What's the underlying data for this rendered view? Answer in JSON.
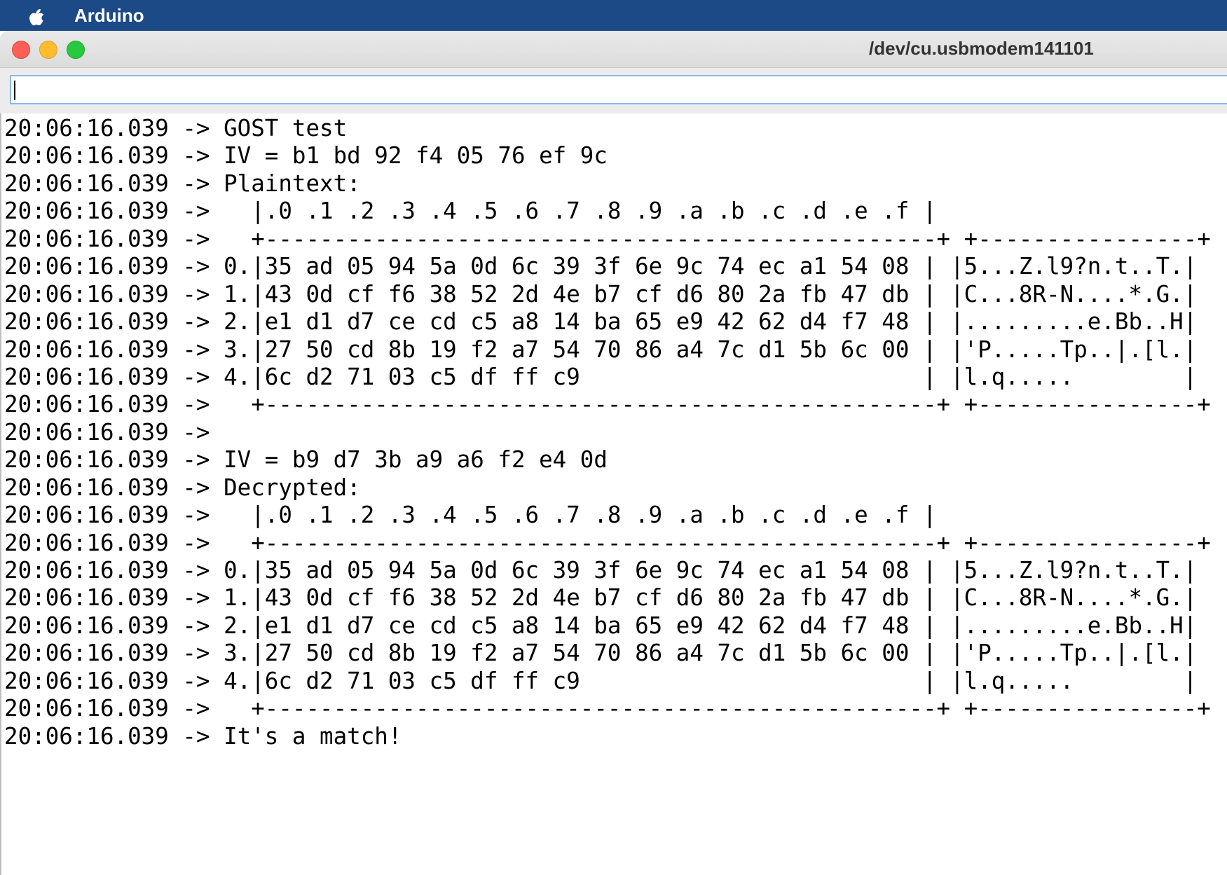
{
  "menubar": {
    "apple_icon": "apple-logo-icon",
    "app_name": "Arduino"
  },
  "window": {
    "title": "/dev/cu.usbmodem141101",
    "traffic_lights": [
      "close-icon",
      "minimize-icon",
      "zoom-icon"
    ]
  },
  "send_input": {
    "value": ""
  },
  "serial_output": {
    "lines": [
      "20:06:16.039 -> GOST test",
      "20:06:16.039 -> IV = b1 bd 92 f4 05 76 ef 9c",
      "20:06:16.039 -> Plaintext:",
      "20:06:16.039 ->   |.0 .1 .2 .3 .4 .5 .6 .7 .8 .9 .a .b .c .d .e .f |",
      "20:06:16.039 ->   +-------------------------------------------------+ +----------------+",
      "20:06:16.039 -> 0.|35 ad 05 94 5a 0d 6c 39 3f 6e 9c 74 ec a1 54 08 | |5...Z.l9?n.t..T.|",
      "20:06:16.039 -> 1.|43 0d cf f6 38 52 2d 4e b7 cf d6 80 2a fb 47 db | |C...8R-N....*.G.|",
      "20:06:16.039 -> 2.|e1 d1 d7 ce cd c5 a8 14 ba 65 e9 42 62 d4 f7 48 | |.........e.Bb..H|",
      "20:06:16.039 -> 3.|27 50 cd 8b 19 f2 a7 54 70 86 a4 7c d1 5b 6c 00 | |'P.....Tp..|.[l.|",
      "20:06:16.039 -> 4.|6c d2 71 03 c5 df ff c9                         | |l.q.....        |",
      "20:06:16.039 ->   +-------------------------------------------------+ +----------------+",
      "20:06:16.039 -> ",
      "20:06:16.039 -> IV = b9 d7 3b a9 a6 f2 e4 0d",
      "20:06:16.039 -> Decrypted:",
      "20:06:16.039 ->   |.0 .1 .2 .3 .4 .5 .6 .7 .8 .9 .a .b .c .d .e .f |",
      "20:06:16.039 ->   +-------------------------------------------------+ +----------------+",
      "20:06:16.039 -> 0.|35 ad 05 94 5a 0d 6c 39 3f 6e 9c 74 ec a1 54 08 | |5...Z.l9?n.t..T.|",
      "20:06:16.039 -> 1.|43 0d cf f6 38 52 2d 4e b7 cf d6 80 2a fb 47 db | |C...8R-N....*.G.|",
      "20:06:16.039 -> 2.|e1 d1 d7 ce cd c5 a8 14 ba 65 e9 42 62 d4 f7 48 | |.........e.Bb..H|",
      "20:06:16.039 -> 3.|27 50 cd 8b 19 f2 a7 54 70 86 a4 7c d1 5b 6c 00 | |'P.....Tp..|.[l.|",
      "20:06:16.039 -> 4.|6c d2 71 03 c5 df ff c9                         | |l.q.....        |",
      "20:06:16.039 ->   +-------------------------------------------------+ +----------------+",
      "20:06:16.039 -> It's a match!"
    ]
  }
}
